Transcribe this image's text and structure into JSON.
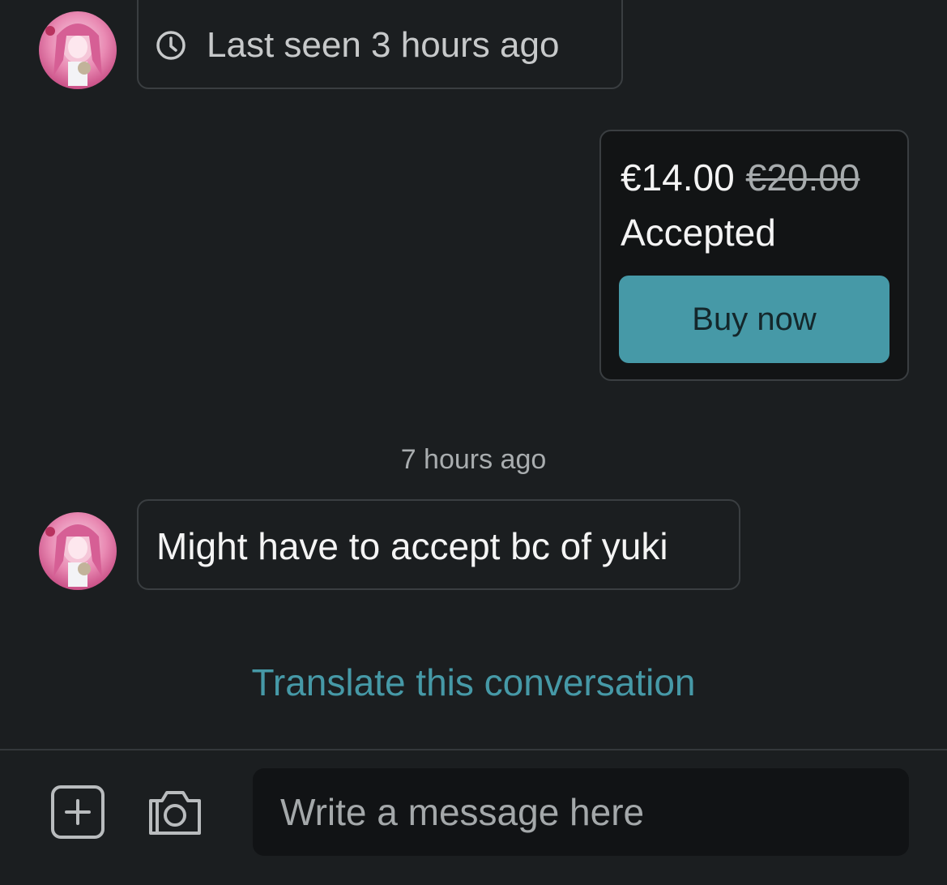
{
  "header_bubble": {
    "cut_text": "",
    "last_seen": "Last seen 3 hours ago",
    "icon": "clock-icon"
  },
  "offer": {
    "price": "€14.00",
    "original_price": "€20.00",
    "status": "Accepted",
    "buy_label": "Buy now",
    "accent_color": "#4699a7"
  },
  "timestamp": "7 hours ago",
  "message": {
    "text": "Might have to accept bc of yuki"
  },
  "translate_link": "Translate this conversation",
  "composer": {
    "placeholder": "Write a message here",
    "attach_icon": "plus-square-icon",
    "camera_icon": "camera-icon"
  },
  "colors": {
    "background": "#1b1e20",
    "bubble_border": "#3a3e41",
    "link": "#4699a7"
  }
}
